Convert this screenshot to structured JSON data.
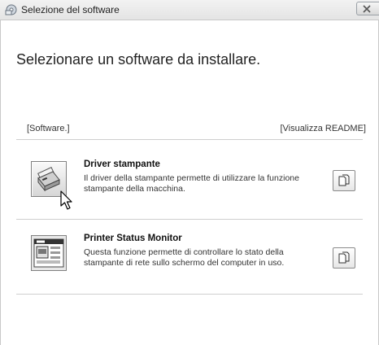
{
  "window": {
    "title": "Selezione del software",
    "close_icon": "close-icon",
    "app_icon": "software-install-icon"
  },
  "main": {
    "heading": "Selezionare un software da installare.",
    "section_label": "[Software.]",
    "readme_link": "[Visualizza README]"
  },
  "items": [
    {
      "title": "Driver stampante",
      "description": "Il driver della stampante permette di utilizzare la funzione stampante della macchina.",
      "icon": "printer-driver-icon",
      "readme_icon": "document-icon"
    },
    {
      "title": "Printer Status Monitor",
      "description": "Questa funzione permette di controllare lo stato della stampante di rete sullo schermo del computer in uso.",
      "icon": "status-monitor-icon",
      "readme_icon": "document-icon"
    }
  ],
  "colors": {
    "divider": "#cfcfcf",
    "text": "#222222"
  }
}
